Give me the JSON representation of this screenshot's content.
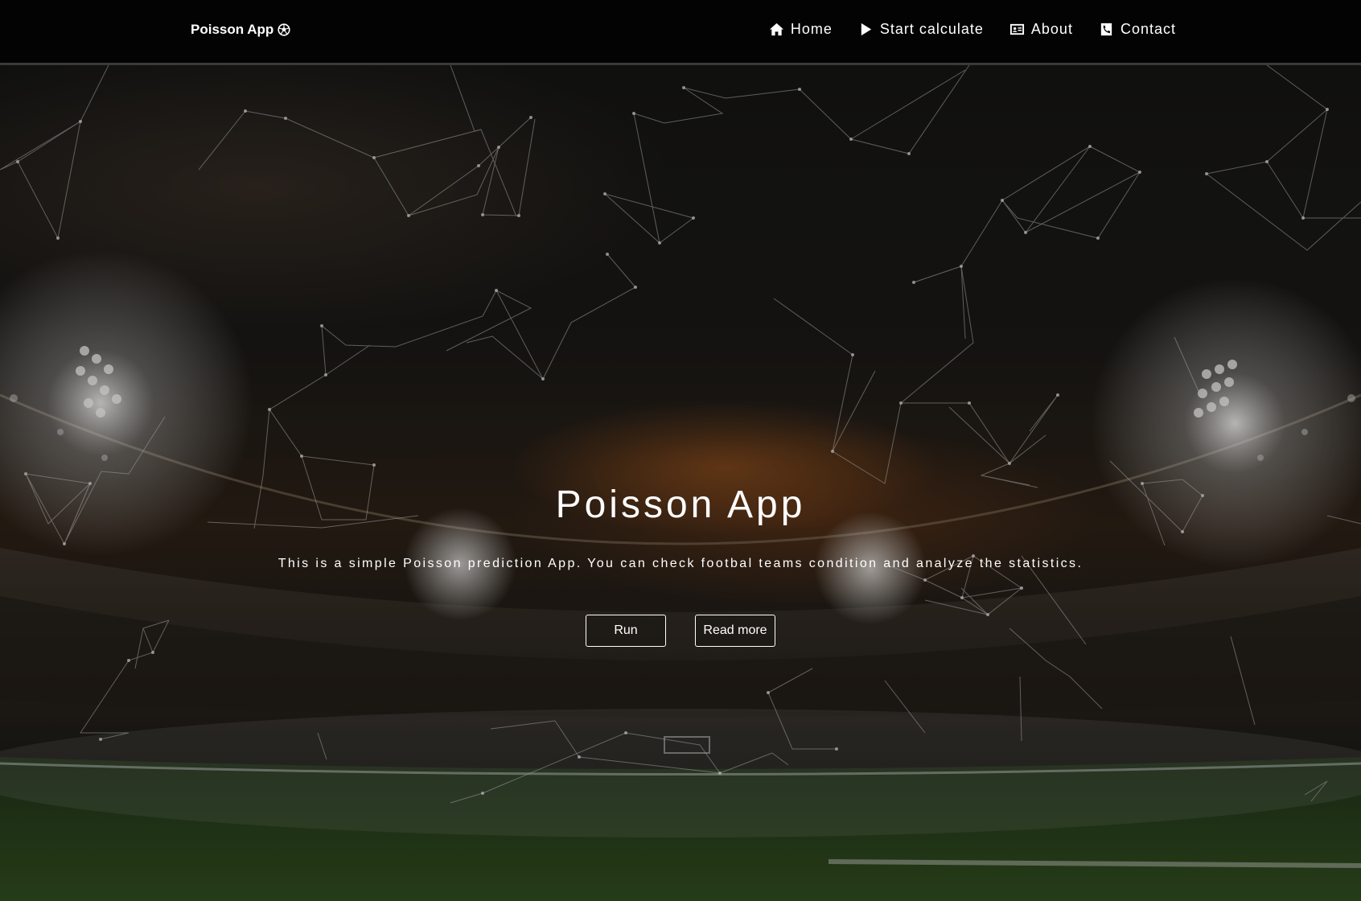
{
  "navbar": {
    "brand": "Poisson App",
    "brand_icon": "soccer-ball-icon",
    "items": [
      {
        "label": "Home",
        "icon": "home-icon"
      },
      {
        "label": "Start calculate",
        "icon": "play-icon"
      },
      {
        "label": "About",
        "icon": "id-card-icon"
      },
      {
        "label": "Contact",
        "icon": "phone-icon"
      }
    ]
  },
  "hero": {
    "title": "Poisson App",
    "description": "This is a simple Poisson prediction App. You can check footbal teams condition and analyze the statistics.",
    "buttons": {
      "run": "Run",
      "read_more": "Read more"
    }
  },
  "colors": {
    "navbar_bg": "#030303",
    "text": "#ffffff",
    "network_lines": "#bfbfbf"
  }
}
